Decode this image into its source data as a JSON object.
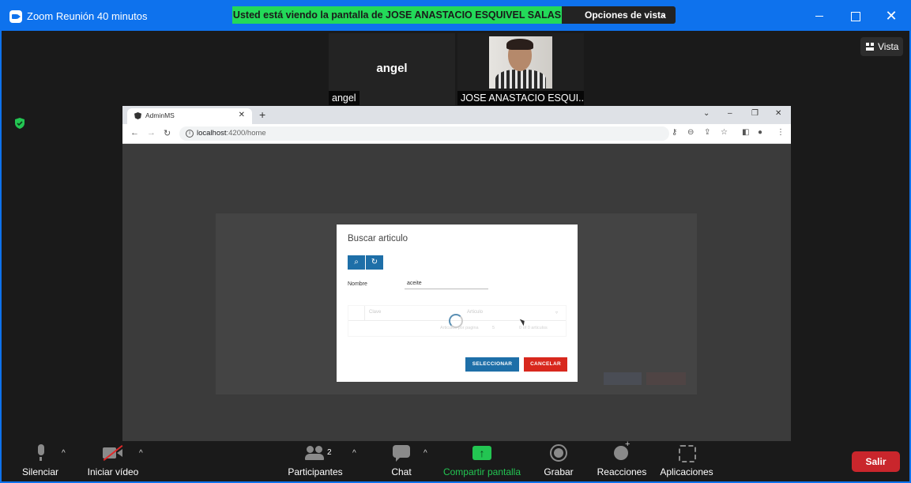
{
  "window": {
    "title": "Zoom Reunión 40 minutos"
  },
  "banner": {
    "text": "Usted está viendo la pantalla de JOSE ANASTACIO ESQUIVEL SALAS",
    "view_options": "Opciones de vista"
  },
  "tiles": [
    {
      "name_center": "angel",
      "label": "angel"
    },
    {
      "label": "JOSE ANASTACIO ESQUI..."
    }
  ],
  "vista": {
    "label": "Vista"
  },
  "browser": {
    "tab_title": "AdminMS",
    "url_host": "localhost",
    "url_path": ":4200/home"
  },
  "modal": {
    "title": "Buscar articulo",
    "field_label": "Nombre",
    "field_value": "aceite",
    "grid": {
      "col_clave": "Clave",
      "col_articulo": "Articulo",
      "footer_per_page": "Articulos por pagina",
      "per_page_value": "5",
      "footer_range": "0 of 0 articulos"
    },
    "select_button": "SELECCIONAR",
    "cancel_button": "CANCELAR"
  },
  "toolbar": {
    "mute": "Silenciar",
    "video": "Iniciar vídeo",
    "participants": "Participantes",
    "participants_count": "2",
    "chat": "Chat",
    "share": "Compartir pantalla",
    "record": "Grabar",
    "reactions": "Reacciones",
    "apps": "Aplicaciones",
    "leave": "Salir"
  },
  "colors": {
    "zoom_blue": "#0e72ed",
    "share_green": "#23d959",
    "leave_red": "#c9262c",
    "primary_button": "#1e6fa8",
    "cancel_button": "#d8281d"
  }
}
